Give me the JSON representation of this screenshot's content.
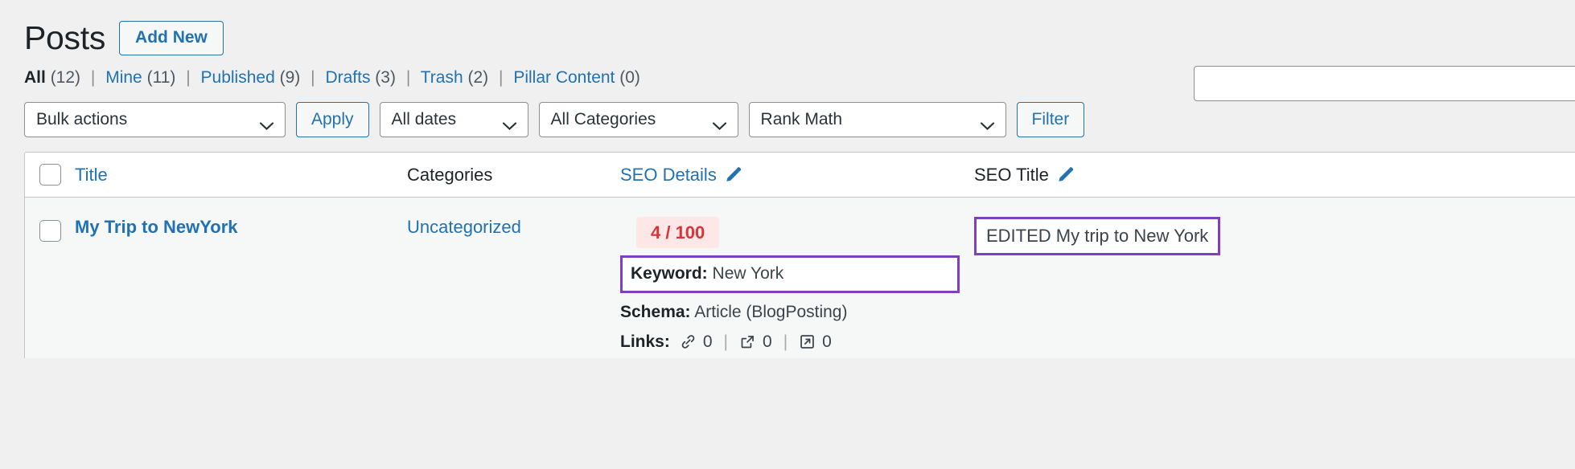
{
  "header": {
    "title": "Posts",
    "add_new_label": "Add New"
  },
  "search": {
    "value": "",
    "placeholder": ""
  },
  "filter_links": [
    {
      "label": "All",
      "count": "(12)",
      "current": true
    },
    {
      "label": "Mine",
      "count": "(11)",
      "current": false
    },
    {
      "label": "Published",
      "count": "(9)",
      "current": false
    },
    {
      "label": "Drafts",
      "count": "(3)",
      "current": false
    },
    {
      "label": "Trash",
      "count": "(2)",
      "current": false
    },
    {
      "label": "Pillar Content",
      "count": "(0)",
      "current": false
    }
  ],
  "filter_separator": "|",
  "toolbar": {
    "bulk_actions_value": "Bulk actions",
    "apply_label": "Apply",
    "dates_value": "All dates",
    "categories_value": "All Categories",
    "rank_math_value": "Rank Math",
    "filter_label": "Filter"
  },
  "table": {
    "columns": {
      "title": "Title",
      "categories": "Categories",
      "seo_details": "SEO Details",
      "seo_title": "SEO Title"
    },
    "edit_icon_name": "pencil-edit-icon",
    "rows": [
      {
        "title": "My Trip to NewYork",
        "categories": "Uncategorized",
        "seo_score": "4 / 100",
        "seo_score_color": "#d63638",
        "seo_score_bg": "#fde8e7",
        "keyword_label": "Keyword:",
        "keyword_value": "New York",
        "schema_label": "Schema:",
        "schema_value": "Article (BlogPosting)",
        "links_label": "Links:",
        "links": [
          {
            "icon": "chain-link-icon",
            "count": "0"
          },
          {
            "icon": "external-link-icon",
            "count": "0"
          },
          {
            "icon": "internal-link-icon",
            "count": "0"
          }
        ],
        "links_divider": "|",
        "seo_title": "EDITED My trip to New York"
      }
    ]
  },
  "highlight_color": "#7f3fbf",
  "accent_color": "#2271b1"
}
